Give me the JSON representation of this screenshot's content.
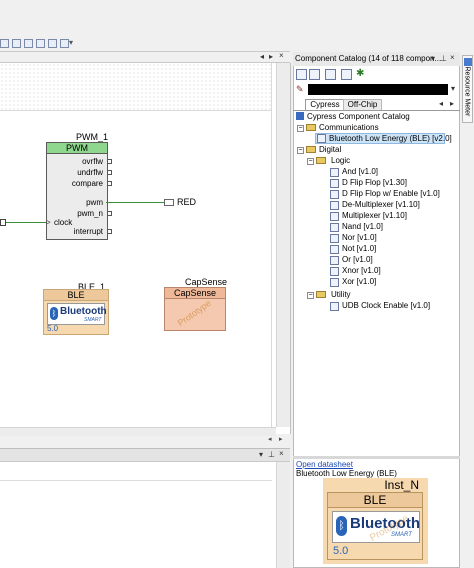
{
  "catalog": {
    "title": "Component Catalog (14 of 118 compon...",
    "tabs": [
      "Cypress",
      "Off-Chip"
    ],
    "root": "Cypress Component Catalog",
    "communications": "Communications",
    "ble_item": "Bluetooth Low Energy (BLE) [v2.0]",
    "digital": "Digital",
    "logic": "Logic",
    "logic_items": [
      "And [v1.0]",
      "D Flip Flop [v1.30]",
      "D Flip Flop w/ Enable [v1.0]",
      "De-Multiplexer [v1.10]",
      "Multiplexer [v1.10]",
      "Nand [v1.0]",
      "Nor [v1.0]",
      "Not [v1.0]",
      "Or [v1.0]",
      "Xnor [v1.0]",
      "Xor [v1.0]"
    ],
    "utility": "Utility",
    "udb_item": "UDB Clock Enable [v1.0]",
    "datasheet_link": "Open datasheet",
    "preview_caption": "Bluetooth Low Energy (BLE)",
    "preview_inst": "Inst_N",
    "preview_ble": "BLE",
    "preview_bt": "Bluetooth",
    "preview_smart": "SMART",
    "preview_version": "5.0",
    "preview_watermark": "Prototype"
  },
  "side_tab": "Resource Meter",
  "schematic": {
    "pwm_name": "PWM_1",
    "pwm_type": "PWM",
    "pwm_pins_right": [
      "ovrflw",
      "undrflw",
      "compare"
    ],
    "pwm_pins_lower": [
      "pwm",
      "pwm_n",
      "interrupt"
    ],
    "pwm_clock": "clock",
    "red_label": "RED",
    "ble_name": "BLE_1",
    "ble_type": "BLE",
    "ble_bt": "Bluetooth",
    "ble_smart": "SMART",
    "ble_version": "5.0",
    "capsense_name": "CapSense",
    "capsense_type": "CapSense",
    "watermark": "Prototype"
  },
  "colors": {
    "pwm_header": "#8fd68f",
    "selection": "#cce4f7",
    "ble_bg": "#f7d9b0",
    "capsense_bg": "#f4c9b0",
    "wire": "#3c8c3c"
  }
}
